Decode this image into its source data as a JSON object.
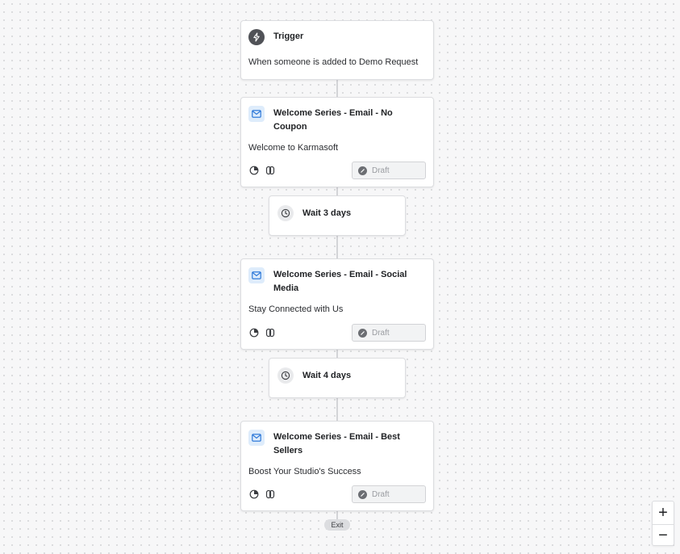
{
  "trigger": {
    "title": "Trigger",
    "description": "When someone is added to Demo Request",
    "icon": "bolt-icon"
  },
  "steps": [
    {
      "title": "Welcome Series - Email - No Coupon",
      "subject": "Welcome to Karmasoft",
      "status": "Draft"
    },
    {
      "wait": "Wait 3 days"
    },
    {
      "title": "Welcome Series - Email - Social Media",
      "subject": "Stay Connected with Us",
      "status": "Draft"
    },
    {
      "wait": "Wait 4 days"
    },
    {
      "title": "Welcome Series - Email - Best Sellers",
      "subject": "Boost Your Studio's Success",
      "status": "Draft"
    }
  ],
  "exit_label": "Exit",
  "zoom": {
    "in": "+",
    "out": "−"
  },
  "colors": {
    "email_icon_bg": "#deecfb",
    "email_icon_fg": "#1f6fd6",
    "trigger_icon_bg": "#505257"
  }
}
